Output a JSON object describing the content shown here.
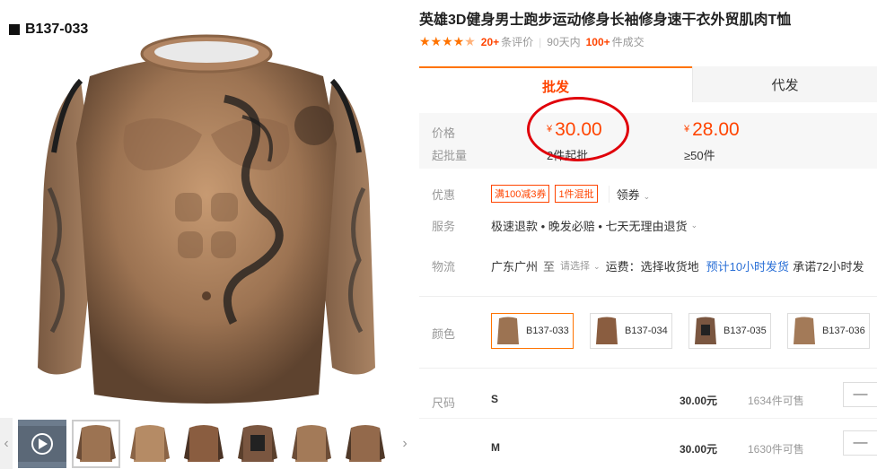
{
  "product": {
    "sku_code": "B137-033",
    "title": "英雄3D健身男士跑步运动修身长袖修身速干衣外贸肌肉T恤",
    "rating": {
      "stars": 4.5,
      "reviews_count": "20+",
      "reviews_label": "条评价",
      "days_label": "90天内",
      "sold_count": "100+",
      "sold_label": "件成交"
    }
  },
  "tabs": [
    {
      "label": "批发",
      "active": true
    },
    {
      "label": "代发",
      "active": false
    }
  ],
  "pricing": {
    "price_label": "价格",
    "moq_label": "起批量",
    "currency": "¥",
    "tiers": [
      {
        "price": "30.00",
        "moq": "2件起批"
      },
      {
        "price": "28.00",
        "moq": "≥50件"
      }
    ]
  },
  "promo": {
    "label": "优惠",
    "coupons": [
      "满100减3券",
      "1件混批"
    ],
    "claim_label": "领券"
  },
  "service": {
    "label": "服务",
    "text": "极速退款 • 晚发必赔 • 七天无理由退货"
  },
  "logistics": {
    "label": "物流",
    "origin": "广东广州",
    "to": "至",
    "select_placeholder": "请选择",
    "fee": "运费：选择收货地",
    "estimate": "预计10小时发货",
    "promise": "承诺72小时发"
  },
  "colors": {
    "label": "颜色",
    "options": [
      "B137-033",
      "B137-034",
      "B137-035",
      "B137-036"
    ],
    "selected": 0
  },
  "sizes": {
    "label": "尺码",
    "rows": [
      {
        "name": "S",
        "price": "30.00元",
        "stock": "1634件可售",
        "minus": "—"
      },
      {
        "name": "M",
        "price": "30.00元",
        "stock": "1630件可售",
        "minus": "—"
      }
    ]
  },
  "icons": {
    "star": "star-icon",
    "chevron": "chevron-down-icon",
    "arrow_left": "arrow-left-icon",
    "arrow_right": "arrow-right-icon",
    "play": "play-icon"
  },
  "colors_theme": {
    "accent": "#ff4400",
    "orange": "#ff7300",
    "annotation_red": "#e0000a",
    "link_blue": "#2a6fd6"
  }
}
